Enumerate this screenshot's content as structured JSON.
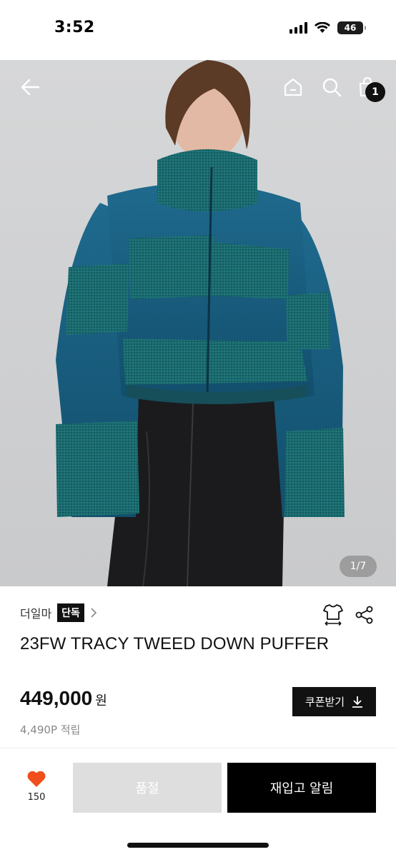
{
  "status_bar": {
    "time": "3:52",
    "battery_level": "46",
    "icons": [
      "cellular-signal-icon",
      "wifi-icon",
      "battery-icon"
    ]
  },
  "hero": {
    "page_indicator": "1/7",
    "cart_count": "1",
    "icons": [
      "back-arrow-icon",
      "home-icon",
      "search-icon",
      "shopping-bag-icon"
    ]
  },
  "product": {
    "brand": "더일마",
    "exclusive_badge": "단독",
    "title": "23FW TRACY TWEED DOWN PUFFER",
    "price": "449,000",
    "price_unit": "원",
    "points": "4,490P 적립",
    "coupon_button": "쿠폰받기"
  },
  "actions": {
    "like_count": "150",
    "soldout_label": "품절",
    "restock_label": "재입고 알림"
  },
  "colors": {
    "accent_heart": "#f04e1b",
    "primary_button": "#000000",
    "disabled_button": "#dedede",
    "jacket_teal": "#1a5f80"
  }
}
